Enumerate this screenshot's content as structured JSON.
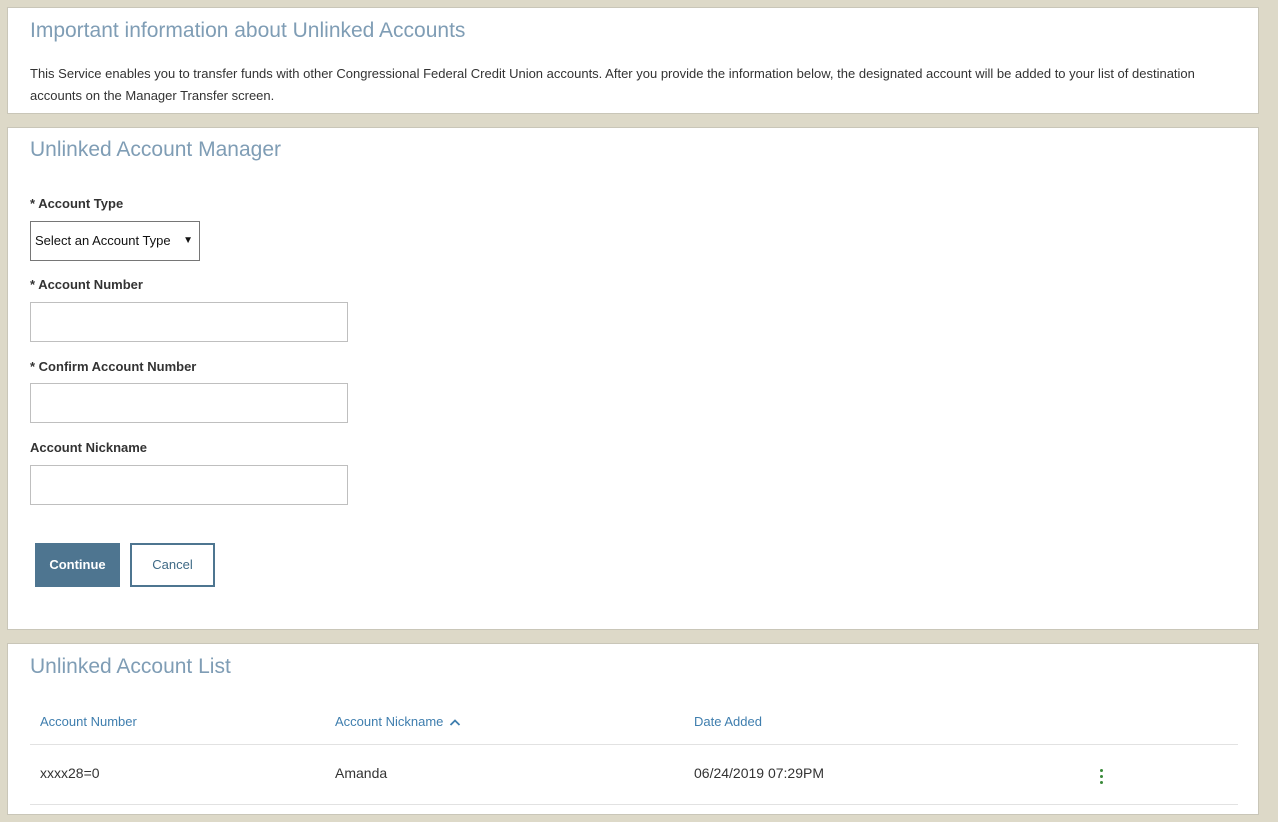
{
  "info": {
    "title": "Important information about Unlinked Accounts",
    "text": "This Service enables you to transfer funds with other Congressional Federal Credit Union accounts. After you provide the information below, the designated account will be added to your list of destination accounts on the Manager Transfer screen."
  },
  "manager": {
    "title": "Unlinked Account Manager",
    "account_type_label": "* Account Type",
    "account_type_selected": "Select an Account Type",
    "account_number_label": "* Account Number",
    "account_number_value": "",
    "confirm_account_number_label": "* Confirm Account Number",
    "confirm_account_number_value": "",
    "nickname_label": "Account Nickname",
    "nickname_value": "",
    "continue_label": "Continue",
    "cancel_label": "Cancel"
  },
  "list": {
    "title": "Unlinked Account List",
    "columns": [
      "Account Number",
      "Account Nickname",
      "Date Added"
    ],
    "sort_indicator": "chevron-up-icon",
    "rows": [
      {
        "account_number": "xxxx28=0",
        "nickname": "Amanda",
        "date_added": "06/24/2019 07:29PM",
        "actions_icon": "kebab-menu-icon"
      }
    ]
  },
  "colors": {
    "page_background": "#ddd9c8",
    "panel_title": "#7f9db5",
    "primary_button": "#4e7590",
    "link": "#3f7eae",
    "actions_icon": "#3a8a3a"
  }
}
